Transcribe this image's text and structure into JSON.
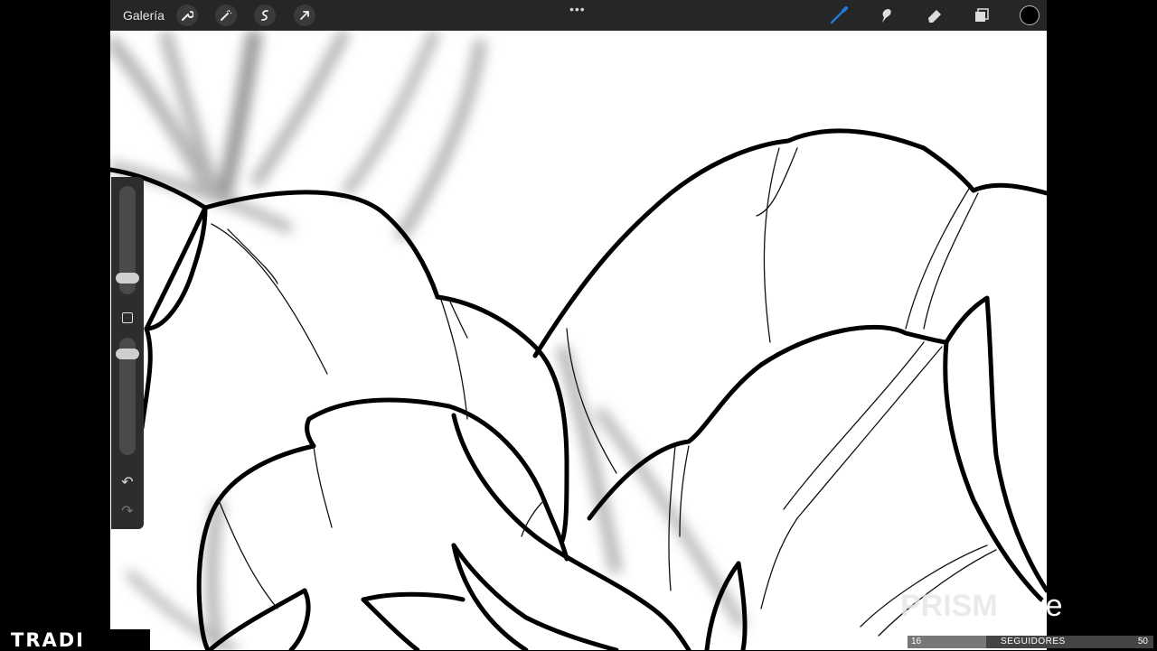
{
  "toolbar": {
    "gallery_label": "Galería",
    "more_dots": "•••",
    "left_tools": [
      "wrench-icon",
      "magic-wand-icon",
      "selection-icon",
      "transform-arrow-icon"
    ],
    "right_tools": [
      "brush-icon",
      "smudge-icon",
      "eraser-icon",
      "layers-icon",
      "color-swatch"
    ],
    "active_tool": "brush",
    "colors": {
      "brush_accent": "#1e7bd8",
      "current_color": "#000000"
    }
  },
  "sidebar": {
    "icons": [
      "brush-size-slider",
      "modify-button",
      "opacity-slider",
      "undo-icon",
      "redo-icon"
    ]
  },
  "overlay": {
    "brand": "TRADI",
    "watermark_prism": "PRISM",
    "watermark_live": "Live",
    "followers_current": "16",
    "followers_label": "SEGUIDORES",
    "followers_goal": "50",
    "followers_progress": 0.32
  }
}
